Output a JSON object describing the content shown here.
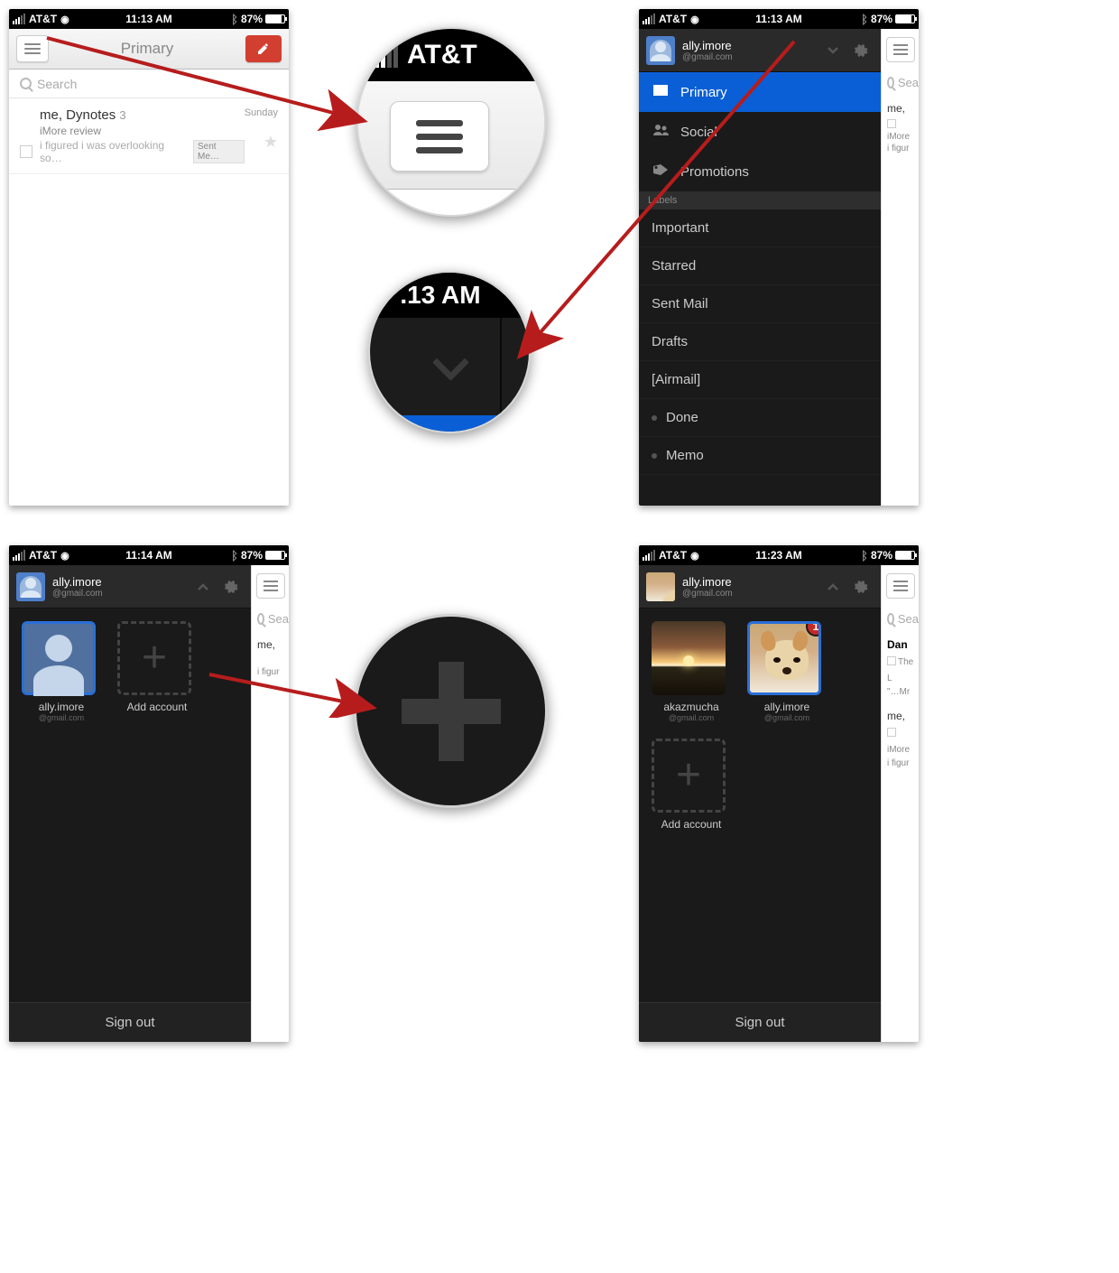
{
  "statusbar": {
    "carrier": "AT&T",
    "battery": "87%"
  },
  "screen1": {
    "time": "11:13 AM",
    "title": "Primary",
    "search_placeholder": "Search",
    "mail": {
      "from": "me, Dynotes",
      "count": "3",
      "subject": "iMore review",
      "snippet": "i figured i was overlooking so…",
      "badge": "Sent Me…",
      "date": "Sunday"
    }
  },
  "screen2": {
    "time": "11:13 AM",
    "account": {
      "name": "ally.imore",
      "email": "@gmail.com"
    },
    "categories": [
      {
        "label": "Primary",
        "icon": "inbox",
        "active": true
      },
      {
        "label": "Social",
        "icon": "people",
        "active": false
      },
      {
        "label": "Promotions",
        "icon": "tag",
        "active": false
      }
    ],
    "labels_header": "Labels",
    "labels": [
      "Important",
      "Starred",
      "Sent Mail",
      "Drafts",
      "[Airmail]"
    ],
    "sublabels": [
      "Done",
      "Memo"
    ],
    "slice": {
      "search": "Sea",
      "from": "me,",
      "sub1": "iMore",
      "sub2": "i figur"
    }
  },
  "screen3": {
    "time": "11:14 AM",
    "account": {
      "name": "ally.imore",
      "email": "@gmail.com"
    },
    "tile1": {
      "name": "ally.imore",
      "email": "@gmail.com"
    },
    "add_label": "Add account",
    "signout": "Sign out",
    "slice": {
      "search": "Sea",
      "from": "me,",
      "sub2": "i figur"
    }
  },
  "screen4": {
    "time": "11:23 AM",
    "account": {
      "name": "ally.imore",
      "email": "@gmail.com"
    },
    "tile1": {
      "name": "akazmucha",
      "email": "@gmail.com"
    },
    "tile2": {
      "name": "ally.imore",
      "email": "@gmail.com",
      "badge": "1"
    },
    "add_label": "Add account",
    "signout": "Sign out",
    "slice": {
      "search": "Sea",
      "from1": "Dan",
      "sub1a": "The L",
      "sub1b": "\"…Mr",
      "from2": "me,",
      "sub2a": "iMore",
      "sub2b": "i figur"
    }
  },
  "mag1": {
    "carrier": "AT&T"
  },
  "mag2": {
    "time": ".13 AM"
  }
}
